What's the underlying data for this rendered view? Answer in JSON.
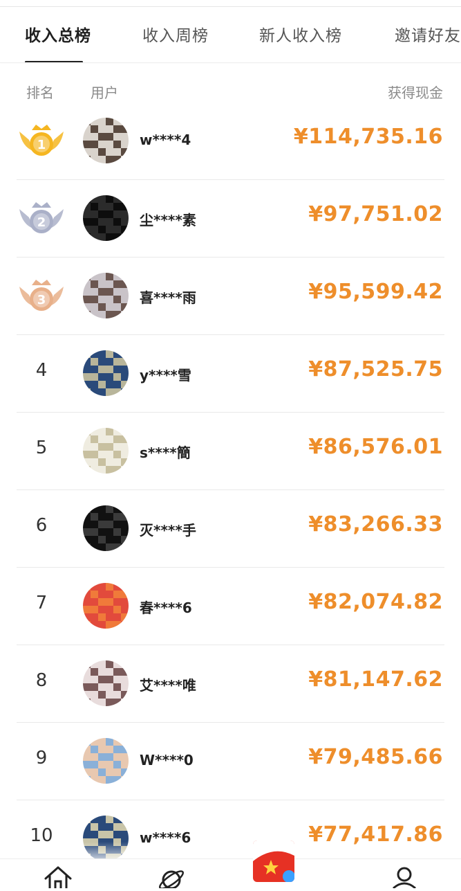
{
  "tabs": [
    {
      "label": "收入总榜",
      "active": true
    },
    {
      "label": "收入周榜",
      "active": false
    },
    {
      "label": "新人收入榜",
      "active": false
    },
    {
      "label": "邀请好友",
      "active": false
    }
  ],
  "table_header": {
    "rank": "排名",
    "user": "用户",
    "cash": "获得现金"
  },
  "rows": [
    {
      "rank": "1",
      "name": "w****4",
      "amount": "¥114,735.16",
      "avatar_colors": [
        "#d9d3cc",
        "#5a4a40"
      ]
    },
    {
      "rank": "2",
      "name": "尘****素",
      "amount": "¥97,751.02",
      "avatar_colors": [
        "#2b2b2b",
        "#0d0d0d"
      ]
    },
    {
      "rank": "3",
      "name": "喜****雨",
      "amount": "¥95,599.42",
      "avatar_colors": [
        "#c9c3c8",
        "#6b5650"
      ]
    },
    {
      "rank": "4",
      "name": "y****雪",
      "amount": "¥87,525.75",
      "avatar_colors": [
        "#2a4a7a",
        "#b8b59a"
      ]
    },
    {
      "rank": "5",
      "name": "s****簡",
      "amount": "¥86,576.01",
      "avatar_colors": [
        "#efece0",
        "#c8c0a0"
      ]
    },
    {
      "rank": "6",
      "name": "灭****手",
      "amount": "¥83,266.33",
      "avatar_colors": [
        "#111111",
        "#3a3a3a"
      ]
    },
    {
      "rank": "7",
      "name": "春****6",
      "amount": "¥82,074.82",
      "avatar_colors": [
        "#e24a3c",
        "#f07a3a"
      ]
    },
    {
      "rank": "8",
      "name": "艾****唯",
      "amount": "¥81,147.62",
      "avatar_colors": [
        "#e8dcdc",
        "#7a5a5a"
      ]
    },
    {
      "rank": "9",
      "name": "W****0",
      "amount": "¥79,485.66",
      "avatar_colors": [
        "#e8c8b0",
        "#8ab0d8"
      ]
    },
    {
      "rank": "10",
      "name": "w****6",
      "amount": "¥77,417.86",
      "avatar_colors": [
        "#2a4a7a",
        "#c8c4a8"
      ]
    }
  ],
  "medal_colors": {
    "gold": "#f5b621",
    "silver": "#aab0c8",
    "bronze": "#e8b08a"
  },
  "accent_color": "#ee8e2b",
  "bottom_nav": [
    {
      "icon": "home-icon"
    },
    {
      "icon": "planet-icon"
    },
    {
      "icon": "app-badge-icon"
    },
    {
      "icon": "profile-icon"
    }
  ]
}
